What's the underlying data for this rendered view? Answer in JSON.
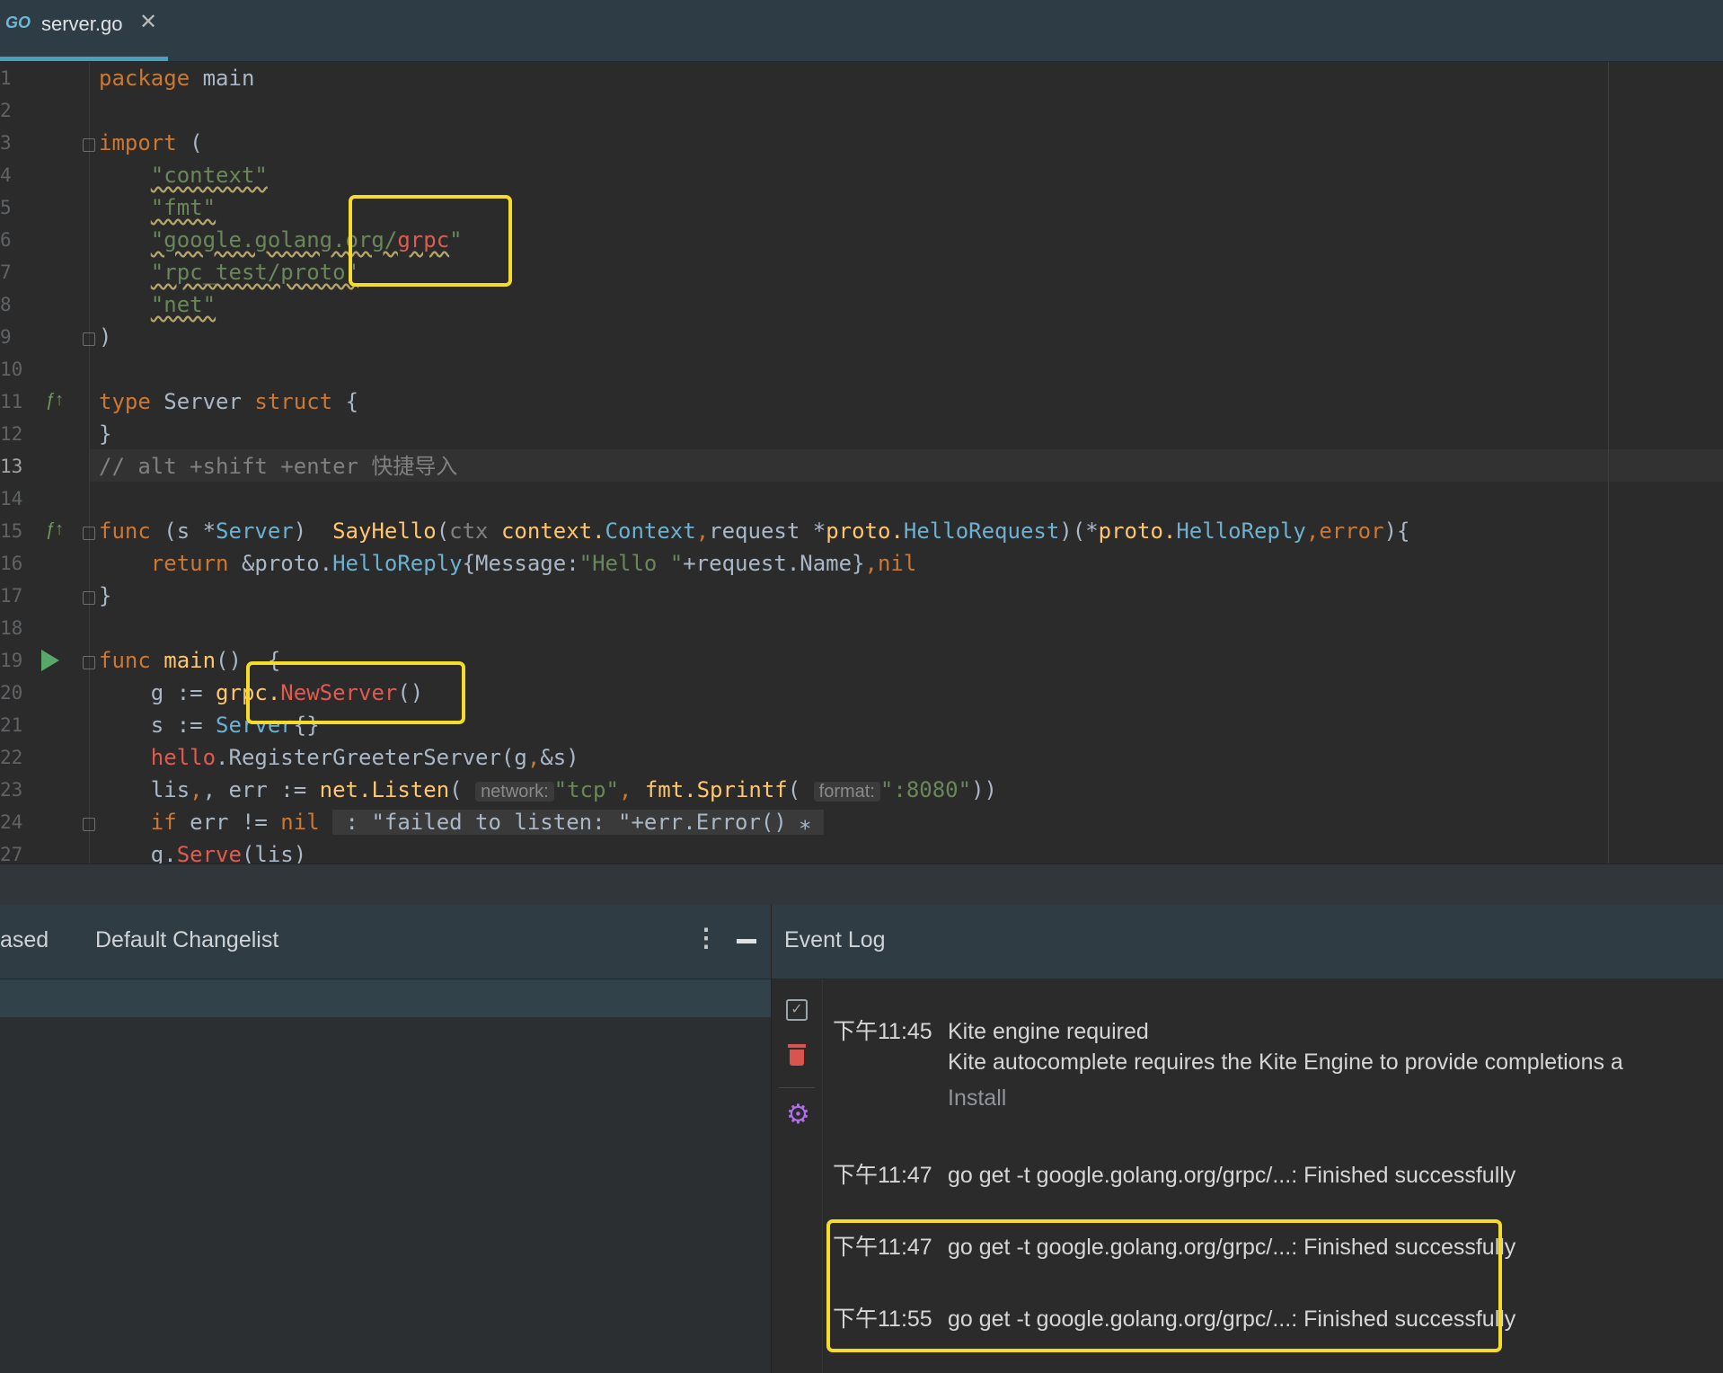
{
  "tab": {
    "icon_text": "GO",
    "filename": "server.go",
    "close_glyph": "✕"
  },
  "editor": {
    "lines": [
      {
        "n": "1"
      },
      {
        "n": "2"
      },
      {
        "n": "3"
      },
      {
        "n": "4"
      },
      {
        "n": "5"
      },
      {
        "n": "6"
      },
      {
        "n": "7"
      },
      {
        "n": "8"
      },
      {
        "n": "9"
      },
      {
        "n": "10"
      },
      {
        "n": "11"
      },
      {
        "n": "12"
      },
      {
        "n": "13"
      },
      {
        "n": "14"
      },
      {
        "n": "15"
      },
      {
        "n": "16"
      },
      {
        "n": "17"
      },
      {
        "n": "18"
      },
      {
        "n": "19"
      },
      {
        "n": "20"
      },
      {
        "n": "21"
      },
      {
        "n": "22"
      },
      {
        "n": "23"
      },
      {
        "n": "24"
      },
      {
        "n": "27"
      }
    ],
    "code": {
      "l1_kw": "package",
      "l1_name": "main",
      "l3_kw": "import",
      "l3_paren": "(",
      "l4": "\"context\"",
      "l5": "\"fmt\"",
      "l6a": "\"google.golang.org/",
      "l6b": "grpc",
      "l6c": "\"",
      "l7": "\"rpc_test/proto\"",
      "l8": "\"net\"",
      "l9": ")",
      "l11_kw1": "type",
      "l11_name": "Server",
      "l11_kw2": "struct",
      "l11_brace": "{",
      "l12": "}",
      "l13": "// alt +shift +enter 快捷导入",
      "l15_kw": "func",
      "l15_recv_open": "(s *",
      "l15_recv_type": "Server",
      "l15_recv_close": ")  ",
      "l15_fn": "SayHello",
      "l15_open": "(",
      "l15_ctx": "ctx ",
      "l15_pkg1": "context.",
      "l15_t1": "Context",
      "l15_comma1": ",",
      "l15_req": "request *",
      "l15_pkg2": "proto.",
      "l15_t2": "HelloRequest",
      "l15_mid": ")(*",
      "l15_pkg3": "proto.",
      "l15_t3": "HelloReply",
      "l15_comma2": ",",
      "l15_err": "error",
      "l15_end": "){",
      "l16_kw": "return",
      "l16_amp": " &proto.",
      "l16_t": "HelloReply",
      "l16_rest1": "{Message:",
      "l16_str": "\"Hello \"",
      "l16_rest2": "+request.Name}",
      "l16_comma": ",",
      "l16_nil": "nil",
      "l17": "}",
      "l19_kw": "func",
      "l19_fn": "main",
      "l19_rest": "()  {",
      "l20_a": "g := ",
      "l20_pkg": "grpc.",
      "l20_fn": "NewServer",
      "l20_end": "()",
      "l21_a": "s := ",
      "l21_t": "Server",
      "l21_end": "{}",
      "l22_a": "hello",
      "l22_b": ".RegisterGreeterServer(g",
      "l22_c": ",",
      "l22_d": "&s)",
      "l23_a": "lis",
      "l23_b": ", err := ",
      "l23_pkg": "net.",
      "l23_fn": "Listen",
      "l23_open": "( ",
      "l23_hint1": "network:",
      "l23_s1": "\"tcp\"",
      "l23_c": ", ",
      "l23_pkg2": "fmt.",
      "l23_fn2": "Sprintf",
      "l23_open2": "( ",
      "l23_hint2": "format:",
      "l23_s2": "\":8080\"",
      "l23_end": "))",
      "l24_kw": "if",
      "l24_a": " err != ",
      "l24_nil": "nil",
      "l24_fold": " : \"failed to listen: \"+err.Error() ⁎ ",
      "l27_a": "g.",
      "l27_fn": "Serve",
      "l27_b": "(lis)"
    }
  },
  "commit_panel": {
    "tab_partial": "ased",
    "changelist": "Default Changelist",
    "menu_glyph": "⋮"
  },
  "event_log": {
    "title": "Event Log",
    "entries": [
      {
        "time": "下午11:45",
        "message": "Kite engine required",
        "detail": "Kite autocomplete requires the Kite Engine to provide completions a",
        "action": "Install"
      },
      {
        "time": "下午11:47",
        "message": "go get -t google.golang.org/grpc/...: Finished successfully"
      },
      {
        "time": "下午11:47",
        "message": "go get -t google.golang.org/grpc/...: Finished successfully"
      },
      {
        "time": "下午11:55",
        "message": "go get -t google.golang.org/grpc/...: Finished successfully"
      }
    ]
  },
  "colors": {
    "highlight": "#f5dc2a",
    "keyword": "#cc7832",
    "string": "#6a8759",
    "error": "#e05a4f"
  }
}
